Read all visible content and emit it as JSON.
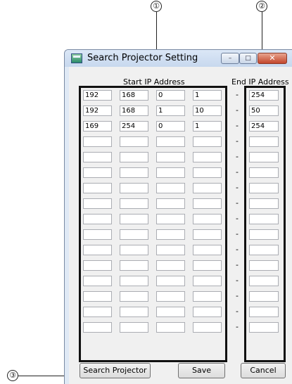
{
  "callouts": {
    "one": "①",
    "two": "②",
    "three": "③"
  },
  "window": {
    "title": "Search Projector Setting",
    "minimize_glyph": "–",
    "maximize_glyph": "□",
    "close_glyph": "✕"
  },
  "columns": {
    "start_label": "Start IP Address",
    "end_label": "End IP Address",
    "separator": "-"
  },
  "rows": [
    {
      "start": [
        "192",
        "168",
        "0",
        "1"
      ],
      "end": "254"
    },
    {
      "start": [
        "192",
        "168",
        "1",
        "10"
      ],
      "end": "50"
    },
    {
      "start": [
        "169",
        "254",
        "0",
        "1"
      ],
      "end": "254"
    },
    {
      "start": [
        "",
        "",
        "",
        ""
      ],
      "end": ""
    },
    {
      "start": [
        "",
        "",
        "",
        ""
      ],
      "end": ""
    },
    {
      "start": [
        "",
        "",
        "",
        ""
      ],
      "end": ""
    },
    {
      "start": [
        "",
        "",
        "",
        ""
      ],
      "end": ""
    },
    {
      "start": [
        "",
        "",
        "",
        ""
      ],
      "end": ""
    },
    {
      "start": [
        "",
        "",
        "",
        ""
      ],
      "end": ""
    },
    {
      "start": [
        "",
        "",
        "",
        ""
      ],
      "end": ""
    },
    {
      "start": [
        "",
        "",
        "",
        ""
      ],
      "end": ""
    },
    {
      "start": [
        "",
        "",
        "",
        ""
      ],
      "end": ""
    },
    {
      "start": [
        "",
        "",
        "",
        ""
      ],
      "end": ""
    },
    {
      "start": [
        "",
        "",
        "",
        ""
      ],
      "end": ""
    },
    {
      "start": [
        "",
        "",
        "",
        ""
      ],
      "end": ""
    },
    {
      "start": [
        "",
        "",
        "",
        ""
      ],
      "end": ""
    }
  ],
  "buttons": {
    "search": "Search Projector",
    "save": "Save",
    "cancel": "Cancel"
  },
  "icons": {
    "app": "projector-app-icon",
    "minimize": "minimize-icon",
    "maximize": "maximize-icon",
    "close": "close-icon"
  }
}
